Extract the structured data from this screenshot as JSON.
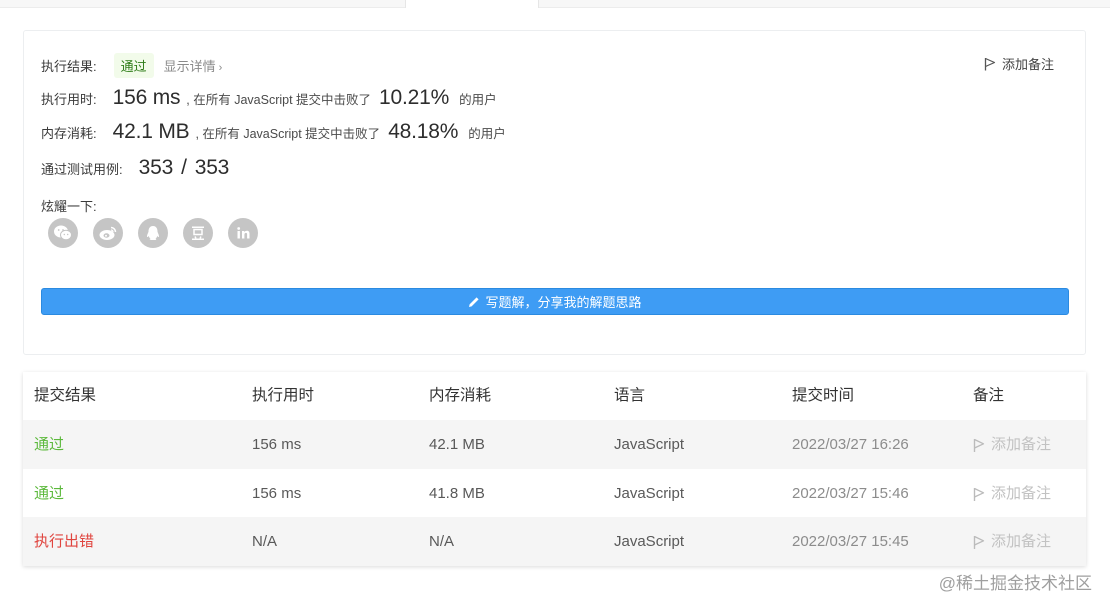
{
  "result": {
    "label": "执行结果:",
    "status": "通过",
    "details_link": "显示详情",
    "details_chevron": "›",
    "add_note": "添加备注"
  },
  "runtime": {
    "label": "执行用时:",
    "value": "156 ms",
    "mid_text": ", 在所有 JavaScript 提交中击败了",
    "percent": "10.21%",
    "suffix": "的用户"
  },
  "memory": {
    "label": "内存消耗:",
    "value": "42.1 MB",
    "mid_text": ", 在所有 JavaScript 提交中击败了",
    "percent": "48.18%",
    "suffix": "的用户"
  },
  "testcases": {
    "label": "通过测试用例:",
    "passed": "353",
    "separator": "/",
    "total": "353"
  },
  "share": {
    "label": "炫耀一下:",
    "icons": [
      "wechat-icon",
      "weibo-icon",
      "qq-icon",
      "douban-icon",
      "linkedin-icon"
    ]
  },
  "write_solution": {
    "label": "写题解，分享我的解题思路",
    "icon": "pencil-icon"
  },
  "table": {
    "headers": [
      "提交结果",
      "执行用时",
      "内存消耗",
      "语言",
      "提交时间",
      "备注"
    ],
    "rows": [
      {
        "result": "通过",
        "runtime": "156 ms",
        "memory": "42.1 MB",
        "language": "JavaScript",
        "time": "2022/03/27 16:26",
        "note": "添加备注"
      },
      {
        "result": "通过",
        "runtime": "156 ms",
        "memory": "41.8 MB",
        "language": "JavaScript",
        "time": "2022/03/27 15:46",
        "note": "添加备注"
      },
      {
        "result": "执行出错",
        "runtime": "N/A",
        "memory": "N/A",
        "language": "JavaScript",
        "time": "2022/03/27 15:45",
        "note": "添加备注"
      }
    ]
  },
  "watermark": "@稀土掘金技术社区",
  "colors": {
    "accent_blue": "#3e9cf4",
    "pass_green": "#5cb93c",
    "error_red": "#e0443e",
    "share_grey": "#c5c5c5"
  }
}
